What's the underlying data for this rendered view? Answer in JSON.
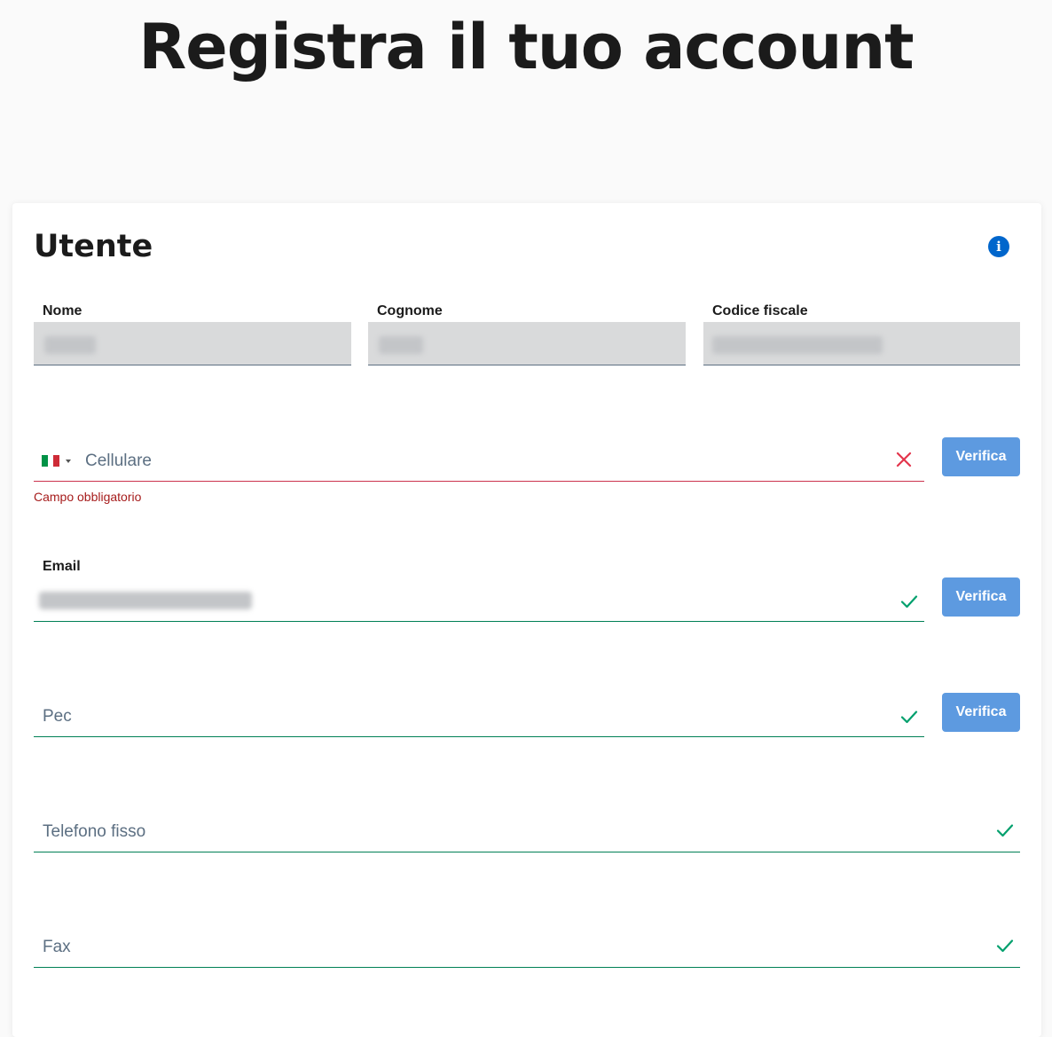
{
  "page": {
    "title": "Registra il tuo account"
  },
  "section": {
    "title": "Utente",
    "info_icon": "info-icon"
  },
  "readonly_fields": {
    "nome_label": "Nome",
    "cognome_label": "Cognome",
    "codice_fiscale_label": "Codice fiscale"
  },
  "cellulare": {
    "country": "IT",
    "placeholder": "Cellulare",
    "error": "Campo obbligatorio",
    "status_icon": "close-icon",
    "verify_label": "Verifica"
  },
  "email": {
    "label": "Email",
    "status_icon": "check-icon",
    "verify_label": "Verifica"
  },
  "pec": {
    "placeholder": "Pec",
    "status_icon": "check-icon",
    "verify_label": "Verifica"
  },
  "telefono_fisso": {
    "placeholder": "Telefono fisso",
    "status_icon": "check-icon"
  },
  "fax": {
    "placeholder": "Fax",
    "status_icon": "check-icon"
  },
  "colors": {
    "valid": "#00a06d",
    "error": "#e3354c",
    "button": "#5d9ae0",
    "info": "#0066cc"
  }
}
